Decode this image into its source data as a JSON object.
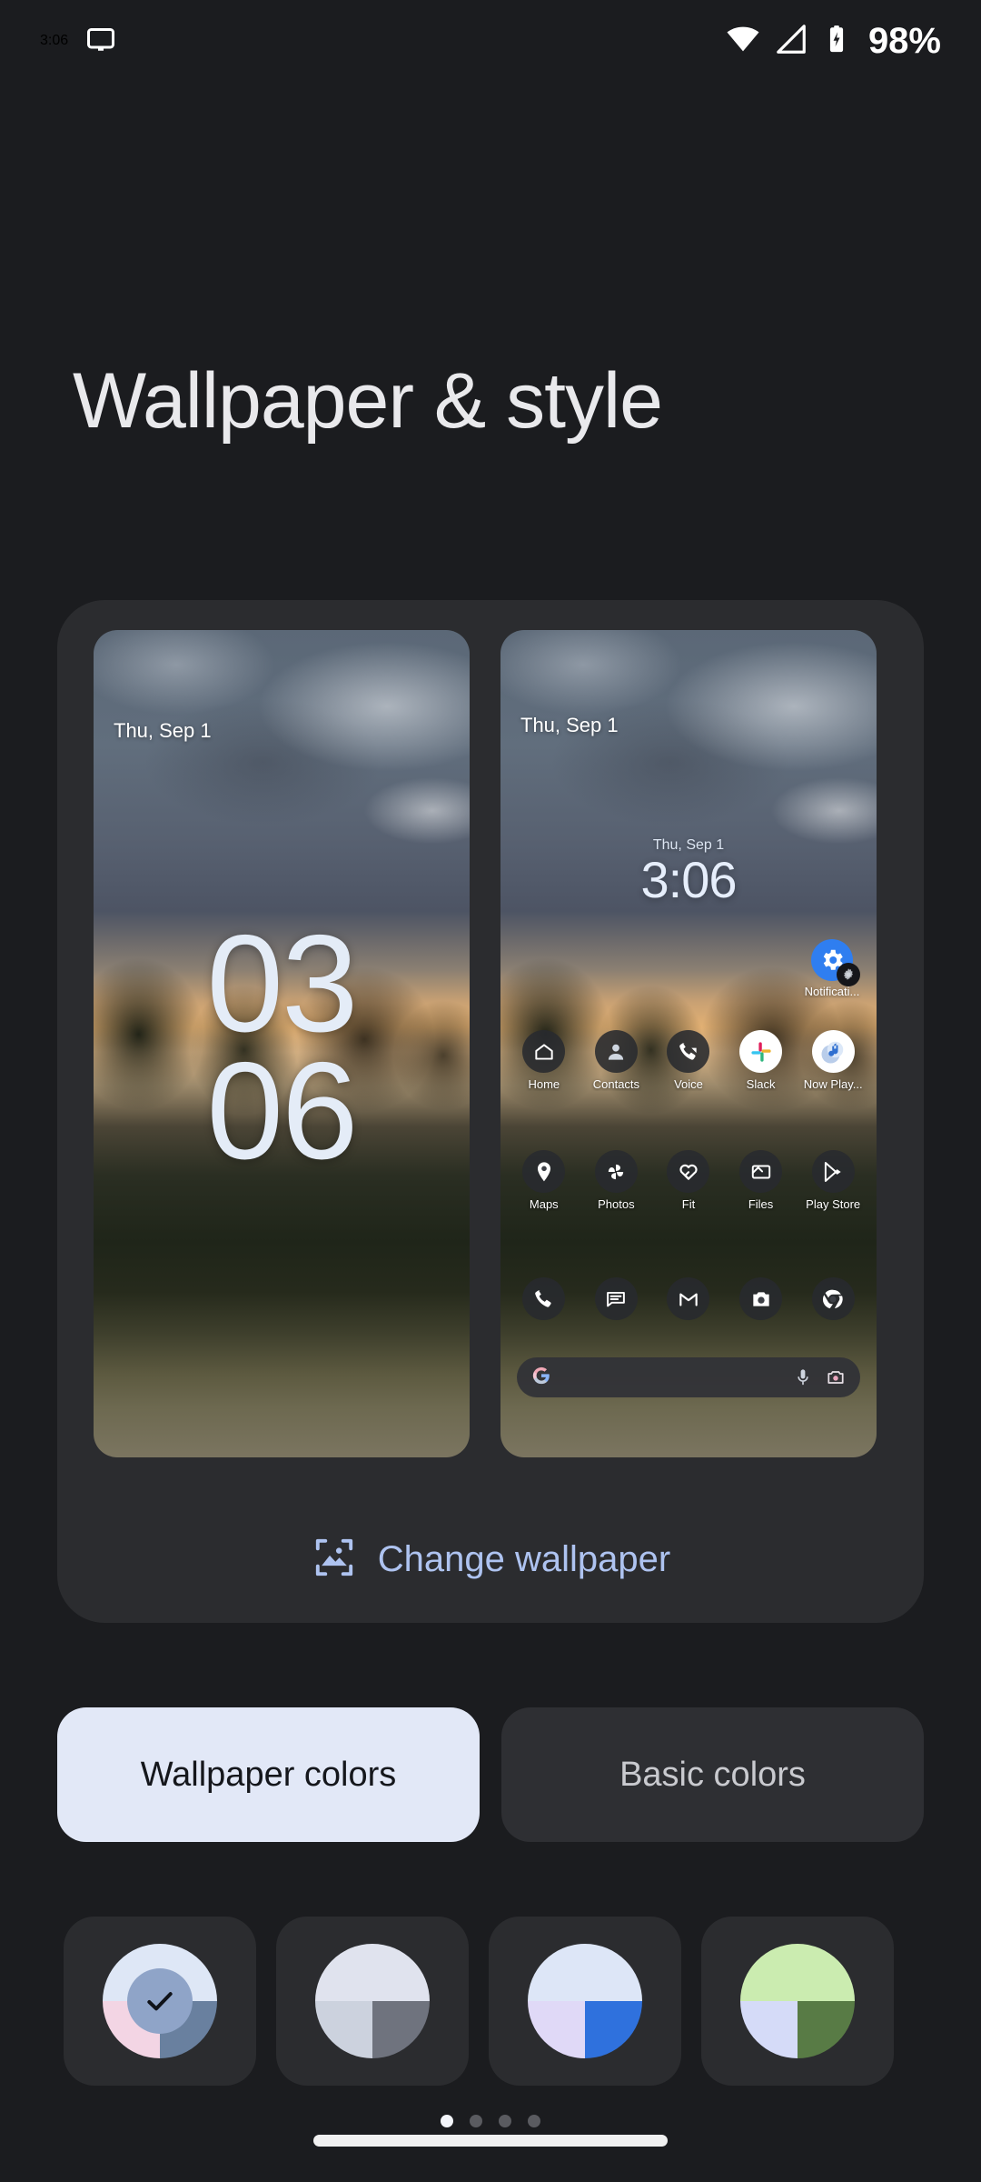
{
  "status_bar": {
    "time": "3:06",
    "battery_percent": "98%",
    "icons": [
      "cast-icon",
      "wifi-icon",
      "cellular-signal-icon",
      "battery-charging-icon"
    ]
  },
  "header": {
    "title": "Wallpaper & style"
  },
  "preview": {
    "lock_screen": {
      "date": "Thu, Sep 1",
      "clock_hours": "03",
      "clock_minutes": "06"
    },
    "home_screen": {
      "status_date": "Thu, Sep 1",
      "widget_date": "Thu, Sep 1",
      "widget_time": "3:06",
      "notification_widget_label": "Notificati...",
      "app_row_1": [
        {
          "label": "Home",
          "icon": "home-icon"
        },
        {
          "label": "Contacts",
          "icon": "contacts-person-icon"
        },
        {
          "label": "Voice",
          "icon": "google-voice-phone-icon"
        },
        {
          "label": "Slack",
          "icon": "slack-icon"
        },
        {
          "label": "Now Play...",
          "icon": "now-playing-music-icon"
        }
      ],
      "app_row_2": [
        {
          "label": "Maps",
          "icon": "maps-pin-icon"
        },
        {
          "label": "Photos",
          "icon": "google-photos-pinwheel-icon"
        },
        {
          "label": "Fit",
          "icon": "google-fit-heart-icon"
        },
        {
          "label": "Files",
          "icon": "files-icon"
        },
        {
          "label": "Play Store",
          "icon": "play-store-icon"
        }
      ],
      "dock": [
        {
          "label": "Phone",
          "icon": "phone-icon"
        },
        {
          "label": "Messages",
          "icon": "messages-icon"
        },
        {
          "label": "Gmail",
          "icon": "gmail-icon"
        },
        {
          "label": "Camera",
          "icon": "camera-icon"
        },
        {
          "label": "Chrome",
          "icon": "chrome-icon"
        }
      ],
      "search_bar": {
        "leading_icon": "google-g-icon",
        "mic_icon": "microphone-icon",
        "lens_icon": "google-lens-camera-icon",
        "value": "",
        "placeholder": ""
      }
    }
  },
  "change_wallpaper": {
    "label": "Change wallpaper",
    "icon": "image-picture-icon"
  },
  "color_tabs": [
    {
      "label": "Wallpaper colors",
      "selected": true
    },
    {
      "label": "Basic colors",
      "selected": false
    }
  ],
  "color_swatches": [
    {
      "name": "swatch-1",
      "selected": true,
      "top": "#dee7f6",
      "top_right": "#dee7f6",
      "bottom_left": "#f3d5e4",
      "bottom_right": "#69809f",
      "center": "#8fa4c8",
      "check_color": "#10131a"
    },
    {
      "name": "swatch-2",
      "selected": false,
      "top": "#e0e3ee",
      "top_right": "#e0e3ee",
      "bottom_left": "#ccd2de",
      "bottom_right": "#6f737e",
      "center": "",
      "check_color": ""
    },
    {
      "name": "swatch-3",
      "selected": false,
      "top": "#dde6f7",
      "top_right": "#dde6f7",
      "bottom_left": "#e0d9f7",
      "bottom_right": "#2f71dd",
      "center": "",
      "check_color": ""
    },
    {
      "name": "swatch-4",
      "selected": false,
      "top": "#cbecb0",
      "top_right": "#cbecb0",
      "bottom_left": "#d5dbf8",
      "bottom_right": "#587b45",
      "center": "",
      "check_color": ""
    }
  ],
  "bottom_nav": {
    "page_dots": [
      {
        "active": true
      },
      {
        "active": false
      },
      {
        "active": false
      },
      {
        "active": false
      }
    ],
    "gesture_pill": "home-gesture-pill"
  },
  "colors": {
    "background": "#1b1c1f",
    "card": "#2b2c2f",
    "accent": "#aec3f0",
    "selected_tab_bg": "#e2e8f7"
  }
}
